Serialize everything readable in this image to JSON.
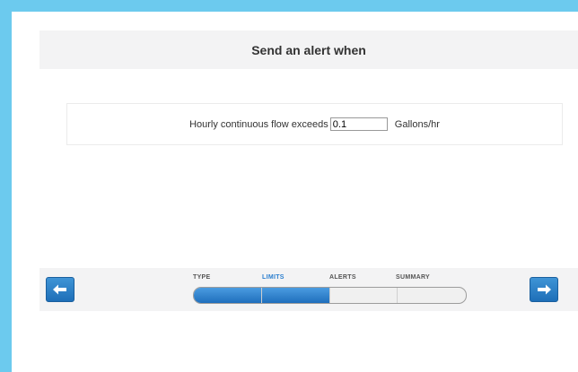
{
  "header": {
    "title": "Send an alert when"
  },
  "condition": {
    "label": "Hourly continuous flow exceeds",
    "value": "0.1",
    "units": "Gallons/hr"
  },
  "wizard": {
    "steps": [
      "TYPE",
      "LIMITS",
      "ALERTS",
      "SUMMARY"
    ],
    "active_step": "LIMITS",
    "progress_fraction": 0.5,
    "back_icon": "arrow-left-icon",
    "next_icon": "arrow-right-icon"
  },
  "colors": {
    "frame": "#6ccaee",
    "accent": "#2b7fcf",
    "button": "#1e6fb8",
    "band": "#f3f3f4"
  }
}
